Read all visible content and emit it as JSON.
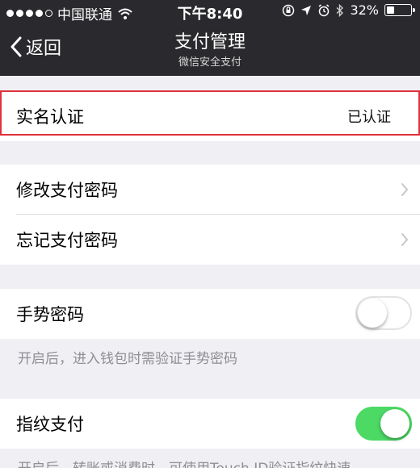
{
  "status_bar": {
    "carrier": "中国联通",
    "time": "下午8:40",
    "battery": "32%",
    "battery_level": 0.32,
    "signal_bars_filled": 4,
    "signal_bars_total": 5
  },
  "nav": {
    "back_label": "返回",
    "title": "支付管理",
    "subtitle": "微信安全支付"
  },
  "items": {
    "real_name": {
      "label": "实名认证",
      "value": "已认证"
    },
    "change_password": {
      "label": "修改支付密码"
    },
    "forgot_password": {
      "label": "忘记支付密码"
    },
    "gesture_password": {
      "label": "手势密码",
      "enabled": false
    },
    "gesture_note": "开启后，进入钱包时需验证手势密码",
    "fingerprint_pay": {
      "label": "指纹支付",
      "enabled": true
    },
    "fingerprint_note": "开启后，转账或消费时，可使用Touch ID验证指纹快速"
  },
  "colors": {
    "nav_background": "#2a2a2e",
    "highlight_border": "#e0313a",
    "toggle_on": "#4cd964",
    "page_background": "#efeff4"
  }
}
